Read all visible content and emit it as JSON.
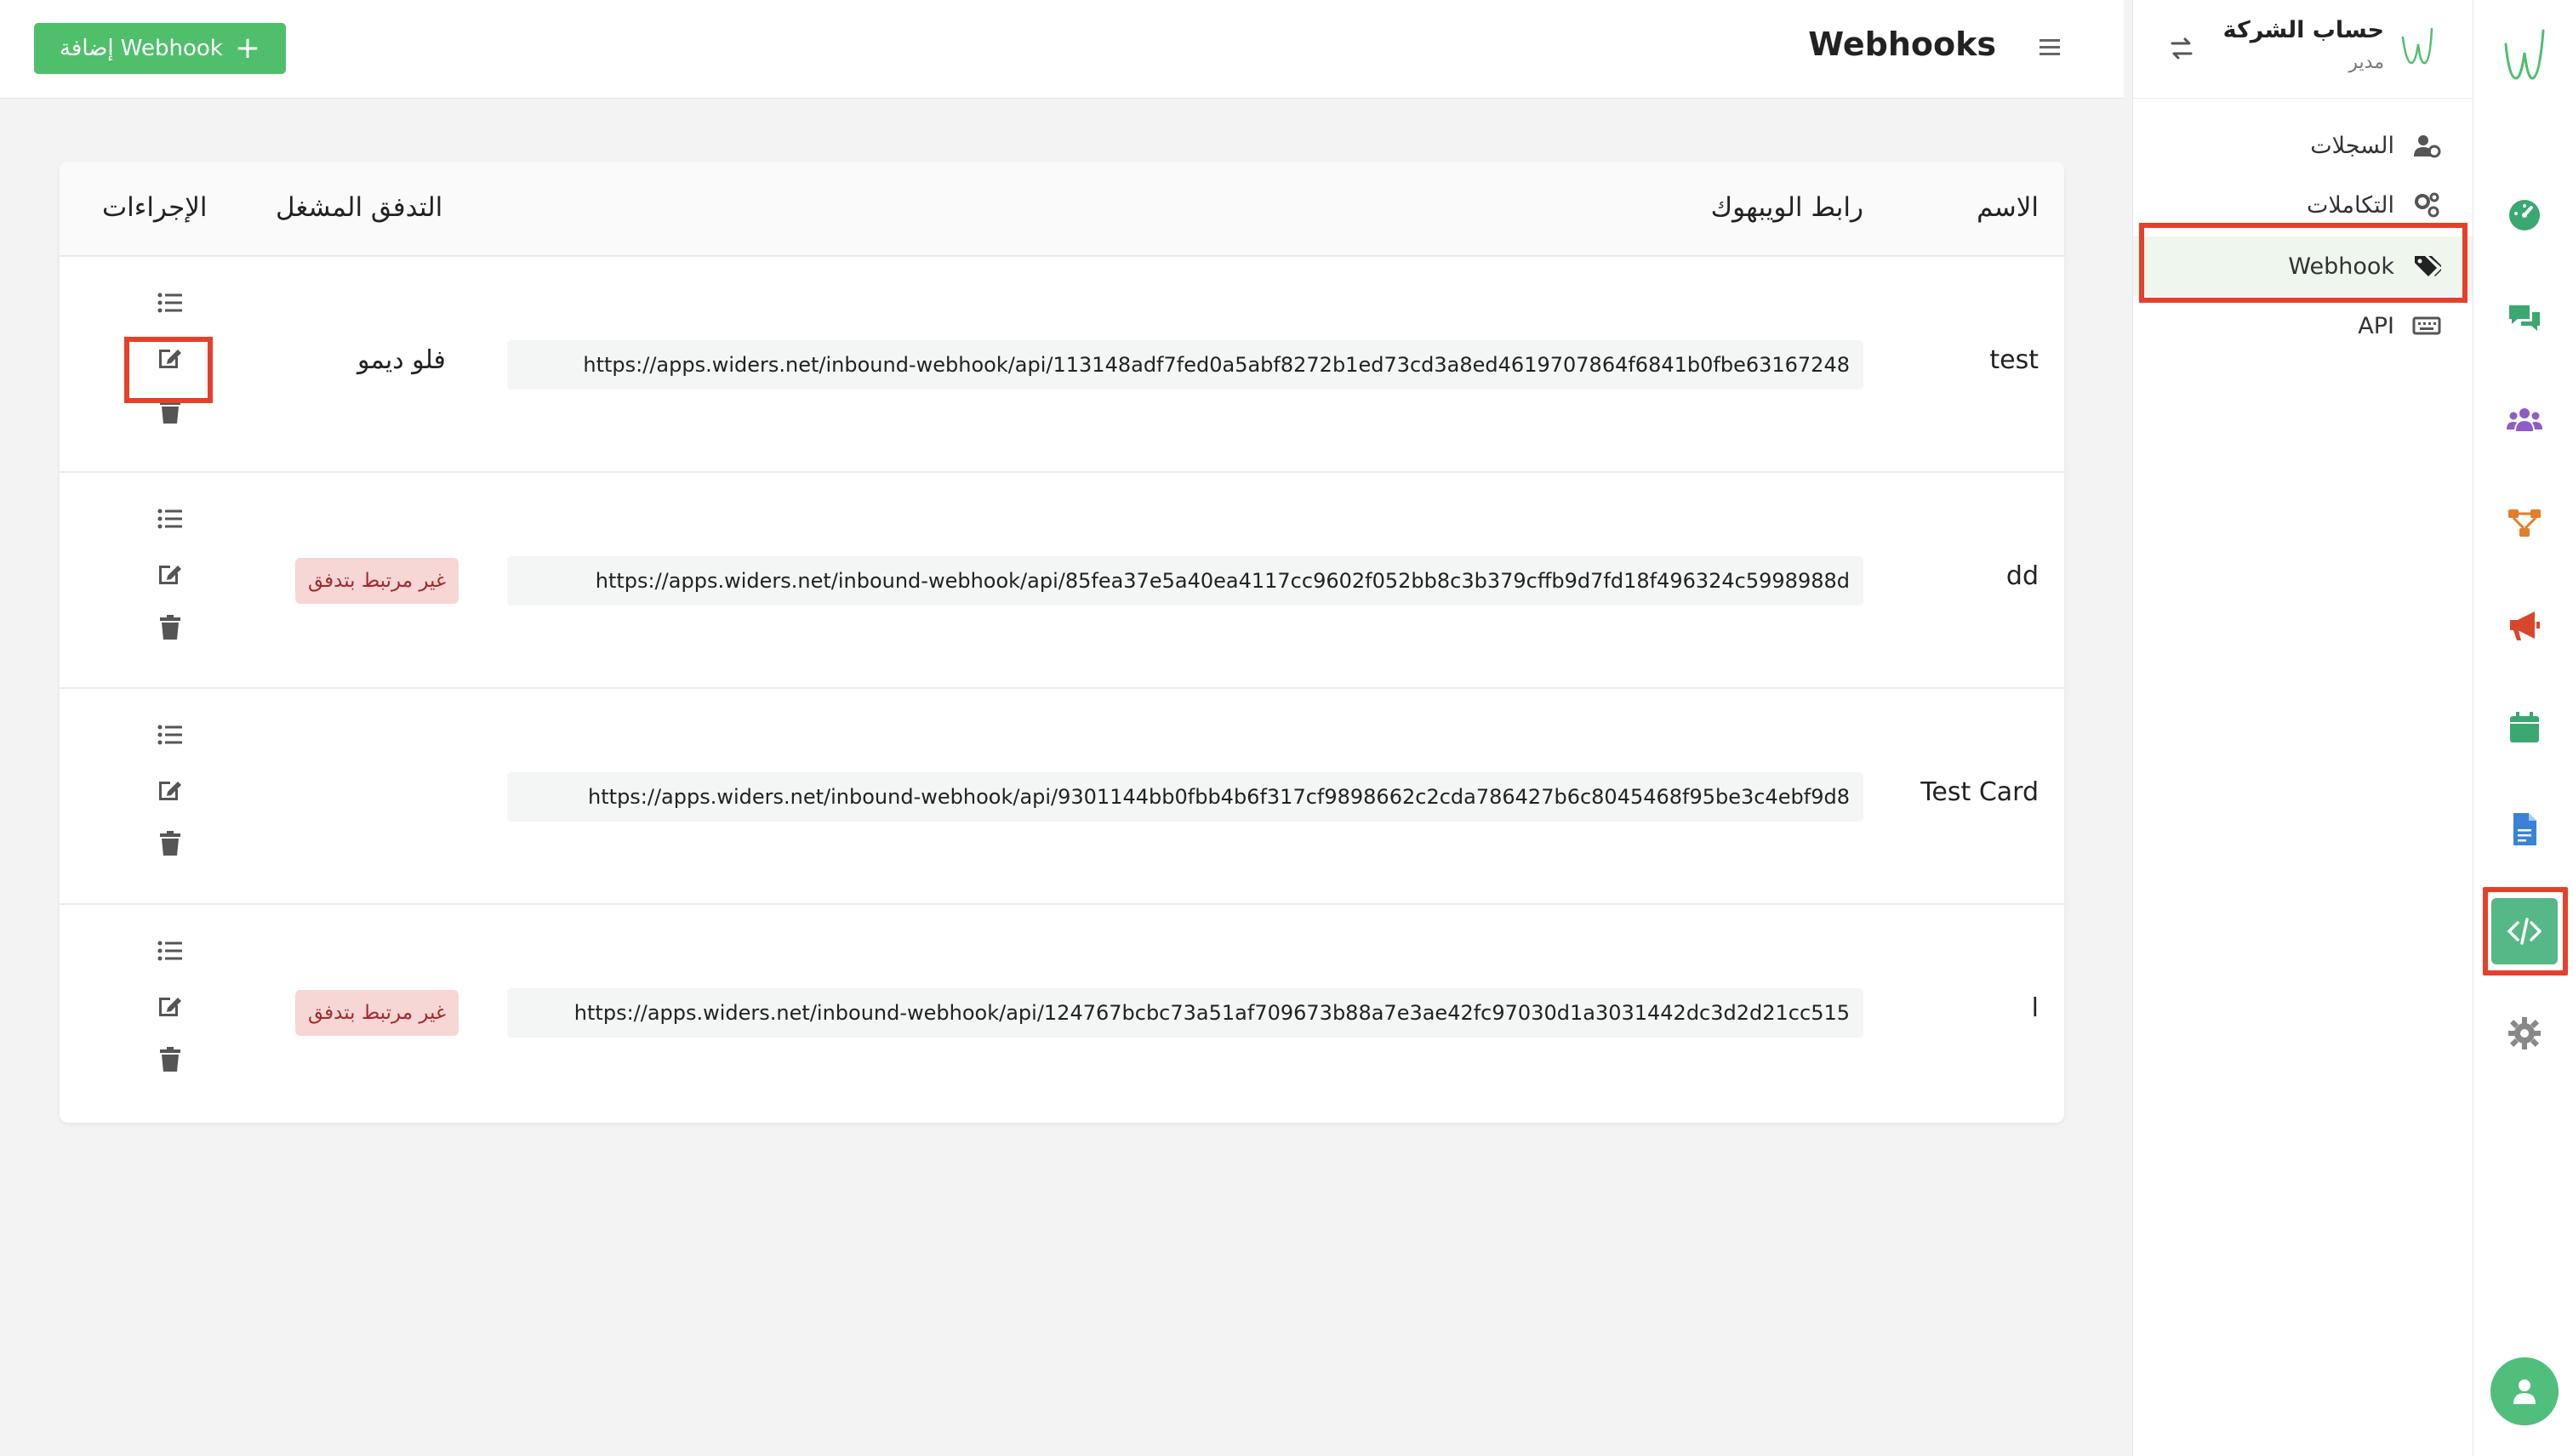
{
  "topbar": {
    "title": "Webhooks",
    "add_button": "إضافة Webhook"
  },
  "sidebar": {
    "company_name": "حساب الشركة",
    "company_role": "مدير",
    "items": [
      {
        "label": "السجلات",
        "icon": "user-cog-icon"
      },
      {
        "label": "التكاملات",
        "icon": "cogs-icon"
      },
      {
        "label": "Webhook",
        "icon": "tags-icon",
        "active": true
      },
      {
        "label": "API",
        "icon": "keyboard-icon"
      }
    ]
  },
  "rail": {
    "items": [
      {
        "icon": "dashboard-icon",
        "color": "#3aa870"
      },
      {
        "icon": "chat-icon",
        "color": "#3aa870"
      },
      {
        "icon": "users-icon",
        "color": "#8e5cc8"
      },
      {
        "icon": "flow-icon",
        "color": "#e27d2b"
      },
      {
        "icon": "megaphone-icon",
        "color": "#d9472b"
      },
      {
        "icon": "calendar-icon",
        "color": "#3aa870"
      },
      {
        "icon": "document-icon",
        "color": "#3b82d6"
      },
      {
        "icon": "code-icon",
        "color": "#ffffff",
        "active": true
      },
      {
        "icon": "gear-icon",
        "color": "#888888"
      }
    ]
  },
  "table": {
    "headers": {
      "name": "الاسم",
      "url": "رابط الويبهوك",
      "flow": "التدفق المشغل",
      "actions": "الإجراءات"
    },
    "rows": [
      {
        "name": "test",
        "url": "https://apps.widers.net/inbound-webhook/api/113148adf7fed0a5abf8272b1ed73cd3a8ed4619707864f6841b0fbe63167248",
        "flow": "فلو ديمو",
        "flow_type": "text"
      },
      {
        "name": "dd",
        "url": "https://apps.widers.net/inbound-webhook/api/85fea37e5a40ea4117cc9602f052bb8c3b379cffb9d7fd18f496324c5998988d",
        "flow": "غير مرتبط بتدفق",
        "flow_type": "badge"
      },
      {
        "name": "Test Card",
        "url": "https://apps.widers.net/inbound-webhook/api/9301144bb0fbb4b6f317cf9898662c2cda786427b6c8045468f95be3c4ebf9d8",
        "flow": "",
        "flow_type": "none"
      },
      {
        "name": "l",
        "url": "https://apps.widers.net/inbound-webhook/api/124767bcbc73a51af709673b88a7e3ae42fc97030d1a3031442dc3d2d21cc515",
        "flow": "غير مرتبط بتدفق",
        "flow_type": "badge"
      }
    ]
  },
  "colors": {
    "accent": "#4fbf6b",
    "highlight": "#e5402b",
    "badge_bg": "#f7d6d6",
    "badge_text": "#a32b2b"
  }
}
